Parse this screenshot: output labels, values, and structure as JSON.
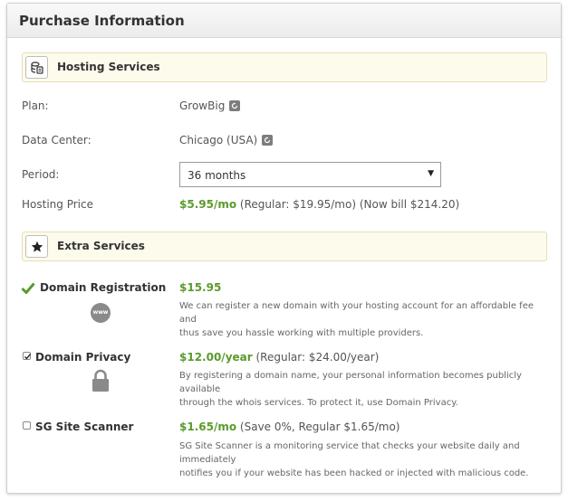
{
  "header": {
    "title": "Purchase Information"
  },
  "hosting": {
    "section_title": "Hosting Services",
    "section_icon": "server-stack-icon",
    "plan_label": "Plan:",
    "plan_value": "GrowBig",
    "datacenter_label": "Data Center:",
    "datacenter_value": "Chicago (USA)",
    "period_label": "Period:",
    "period_value": "36 months",
    "price_label": "Hosting Price",
    "price_value": "$5.95/mo",
    "price_detail": "(Regular: $19.95/mo) (Now bill $214.20)"
  },
  "extras": {
    "section_title": "Extra Services",
    "section_icon": "star-icon",
    "items": [
      {
        "name": "Domain Registration",
        "status_icon": "green-checkmark-icon",
        "icon": "www-globe-icon",
        "price": "$15.95",
        "price_detail": "",
        "desc_line1": "We can register a new domain with your hosting account for an affordable fee and",
        "desc_line2": "thus save you hassle working with multiple providers."
      },
      {
        "name": "Domain Privacy",
        "checked": true,
        "icon": "padlock-icon",
        "price": "$12.00/year",
        "price_detail": "(Regular: $24.00/year)",
        "desc_line1": "By registering a domain name, your personal information becomes publicly available",
        "desc_line2": "through the whois services. To protect it, use Domain Privacy."
      },
      {
        "name": "SG Site Scanner",
        "checked": false,
        "price": "$1.65/mo",
        "price_detail": "(Save 0%, Regular $1.65/mo)",
        "desc_line1": "SG Site Scanner is a monitoring service that checks your website daily and immediately",
        "desc_line2": "notifies you if your website has been hacked or injected with malicious code."
      }
    ]
  },
  "colors": {
    "price_green": "#5b9a2c",
    "section_bg": "#fdfbeb",
    "section_border": "#e3dfb8"
  }
}
